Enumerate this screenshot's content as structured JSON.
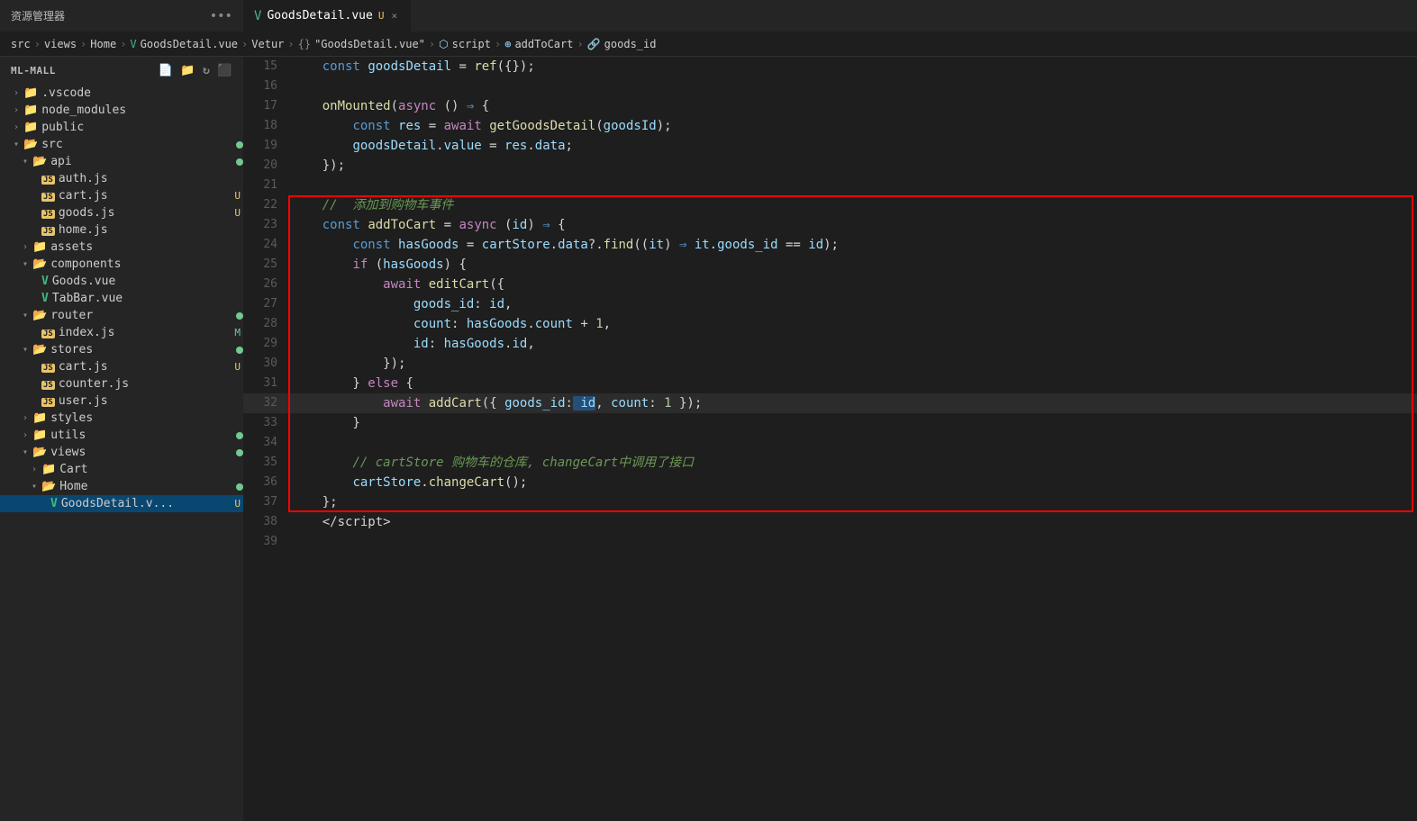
{
  "titleBar": {
    "explorerLabel": "资源管理器",
    "moreIcon": "•••",
    "tab": {
      "name": "GoodsDetail.vue",
      "modified": "U",
      "closeIcon": "×"
    }
  },
  "breadcrumb": {
    "parts": [
      "src",
      ">",
      "views",
      ">",
      "Home",
      ">",
      "GoodsDetail.vue",
      ">",
      "Vetur",
      ">",
      "{}",
      "\"GoodsDetail.vue\"",
      ">",
      "script",
      ">",
      "addToCart",
      ">",
      "goods_id"
    ]
  },
  "sidebar": {
    "title": "ML-MALL",
    "items": [
      {
        "id": "vscode",
        "label": ".vscode",
        "type": "folder",
        "indent": 1,
        "open": false
      },
      {
        "id": "node_modules",
        "label": "node_modules",
        "type": "folder",
        "indent": 1,
        "open": false
      },
      {
        "id": "public",
        "label": "public",
        "type": "folder",
        "indent": 1,
        "open": false
      },
      {
        "id": "src",
        "label": "src",
        "type": "folder",
        "indent": 1,
        "open": true,
        "badge": "dot-green"
      },
      {
        "id": "api",
        "label": "api",
        "type": "folder",
        "indent": 2,
        "open": true,
        "badge": "dot-green"
      },
      {
        "id": "auth.js",
        "label": "auth.js",
        "type": "js",
        "indent": 3
      },
      {
        "id": "cart.js",
        "label": "cart.js",
        "type": "js",
        "indent": 3,
        "badge": "U"
      },
      {
        "id": "goods.js",
        "label": "goods.js",
        "type": "js",
        "indent": 3,
        "badge": "U"
      },
      {
        "id": "home.js",
        "label": "home.js",
        "type": "js",
        "indent": 3
      },
      {
        "id": "assets",
        "label": "assets",
        "type": "folder",
        "indent": 2,
        "open": false
      },
      {
        "id": "components",
        "label": "components",
        "type": "folder",
        "indent": 2,
        "open": true
      },
      {
        "id": "Goods.vue",
        "label": "Goods.vue",
        "type": "vue",
        "indent": 3
      },
      {
        "id": "TabBar.vue",
        "label": "TabBar.vue",
        "type": "vue",
        "indent": 3
      },
      {
        "id": "router",
        "label": "router",
        "type": "folder",
        "indent": 2,
        "open": true,
        "badge": "dot-green"
      },
      {
        "id": "index.js",
        "label": "index.js",
        "type": "js",
        "indent": 3,
        "badge": "M"
      },
      {
        "id": "stores",
        "label": "stores",
        "type": "folder",
        "indent": 2,
        "open": true,
        "badge": "dot-green"
      },
      {
        "id": "cart.js2",
        "label": "cart.js",
        "type": "js",
        "indent": 3,
        "badge": "U"
      },
      {
        "id": "counter.js",
        "label": "counter.js",
        "type": "js",
        "indent": 3
      },
      {
        "id": "user.js",
        "label": "user.js",
        "type": "js",
        "indent": 3
      },
      {
        "id": "styles",
        "label": "styles",
        "type": "folder",
        "indent": 2,
        "open": false
      },
      {
        "id": "utils",
        "label": "utils",
        "type": "folder",
        "indent": 2,
        "open": false,
        "badge": "dot-green"
      },
      {
        "id": "views",
        "label": "views",
        "type": "folder",
        "indent": 2,
        "open": true,
        "badge": "dot-green"
      },
      {
        "id": "Cart",
        "label": "Cart",
        "type": "folder",
        "indent": 3,
        "open": false
      },
      {
        "id": "Home",
        "label": "Home",
        "type": "folder",
        "indent": 3,
        "open": true,
        "badge": "dot-green"
      },
      {
        "id": "GoodsDetail.vue",
        "label": "GoodsDetail.v...",
        "type": "vue",
        "indent": 4,
        "badge": "U",
        "selected": true
      }
    ]
  },
  "editor": {
    "lines": [
      {
        "num": 15,
        "tokens": [
          {
            "t": "plain",
            "v": "    "
          },
          {
            "t": "kw2",
            "v": "const"
          },
          {
            "t": "plain",
            "v": " "
          },
          {
            "t": "var",
            "v": "goodsDetail"
          },
          {
            "t": "plain",
            "v": " = "
          },
          {
            "t": "fn",
            "v": "ref"
          },
          {
            "t": "plain",
            "v": "({});"
          }
        ]
      },
      {
        "num": 16,
        "tokens": []
      },
      {
        "num": 17,
        "tokens": [
          {
            "t": "plain",
            "v": "    "
          },
          {
            "t": "fn",
            "v": "onMounted"
          },
          {
            "t": "plain",
            "v": "("
          },
          {
            "t": "kw",
            "v": "async"
          },
          {
            "t": "plain",
            "v": " () "
          },
          {
            "t": "arrow",
            "v": "⇒"
          },
          {
            "t": "plain",
            "v": " {"
          }
        ]
      },
      {
        "num": 18,
        "tokens": [
          {
            "t": "plain",
            "v": "        "
          },
          {
            "t": "kw2",
            "v": "const"
          },
          {
            "t": "plain",
            "v": " "
          },
          {
            "t": "var",
            "v": "res"
          },
          {
            "t": "plain",
            "v": " = "
          },
          {
            "t": "kw",
            "v": "await"
          },
          {
            "t": "plain",
            "v": " "
          },
          {
            "t": "fn",
            "v": "getGoodsDetail"
          },
          {
            "t": "plain",
            "v": "("
          },
          {
            "t": "var",
            "v": "goodsId"
          },
          {
            "t": "plain",
            "v": ");"
          }
        ]
      },
      {
        "num": 19,
        "tokens": [
          {
            "t": "plain",
            "v": "        "
          },
          {
            "t": "var",
            "v": "goodsDetail"
          },
          {
            "t": "plain",
            "v": "."
          },
          {
            "t": "prop",
            "v": "value"
          },
          {
            "t": "plain",
            "v": " = "
          },
          {
            "t": "var",
            "v": "res"
          },
          {
            "t": "plain",
            "v": "."
          },
          {
            "t": "prop",
            "v": "data"
          },
          {
            "t": "plain",
            "v": ";"
          }
        ]
      },
      {
        "num": 20,
        "tokens": [
          {
            "t": "plain",
            "v": "    });"
          }
        ]
      },
      {
        "num": 21,
        "tokens": []
      },
      {
        "num": 22,
        "tokens": [
          {
            "t": "plain",
            "v": "    "
          },
          {
            "t": "comment",
            "v": "//  添加到购物车事件"
          }
        ],
        "highlighted": true
      },
      {
        "num": 23,
        "tokens": [
          {
            "t": "plain",
            "v": "    "
          },
          {
            "t": "kw2",
            "v": "const"
          },
          {
            "t": "plain",
            "v": " "
          },
          {
            "t": "fn",
            "v": "addToCart"
          },
          {
            "t": "plain",
            "v": " = "
          },
          {
            "t": "kw",
            "v": "async"
          },
          {
            "t": "plain",
            "v": " ("
          },
          {
            "t": "var",
            "v": "id"
          },
          {
            "t": "plain",
            "v": ") "
          },
          {
            "t": "arrow",
            "v": "⇒"
          },
          {
            "t": "plain",
            "v": " {"
          }
        ],
        "highlighted": true
      },
      {
        "num": 24,
        "tokens": [
          {
            "t": "plain",
            "v": "        "
          },
          {
            "t": "kw2",
            "v": "const"
          },
          {
            "t": "plain",
            "v": " "
          },
          {
            "t": "var",
            "v": "hasGoods"
          },
          {
            "t": "plain",
            "v": " = "
          },
          {
            "t": "var",
            "v": "cartStore"
          },
          {
            "t": "plain",
            "v": "."
          },
          {
            "t": "prop",
            "v": "data"
          },
          {
            "t": "plain",
            "v": "?."
          },
          {
            "t": "fn",
            "v": "find"
          },
          {
            "t": "plain",
            "v": "(("
          },
          {
            "t": "var",
            "v": "it"
          },
          {
            "t": "plain",
            "v": ") "
          },
          {
            "t": "arrow",
            "v": "⇒"
          },
          {
            "t": "plain",
            "v": " "
          },
          {
            "t": "var",
            "v": "it"
          },
          {
            "t": "plain",
            "v": "."
          },
          {
            "t": "prop",
            "v": "goods_id"
          },
          {
            "t": "plain",
            "v": " == "
          },
          {
            "t": "var",
            "v": "id"
          },
          {
            "t": "plain",
            "v": ");"
          }
        ],
        "highlighted": true
      },
      {
        "num": 25,
        "tokens": [
          {
            "t": "plain",
            "v": "        "
          },
          {
            "t": "kw",
            "v": "if"
          },
          {
            "t": "plain",
            "v": " ("
          },
          {
            "t": "var",
            "v": "hasGoods"
          },
          {
            "t": "plain",
            "v": ") {"
          }
        ],
        "highlighted": true
      },
      {
        "num": 26,
        "tokens": [
          {
            "t": "plain",
            "v": "            "
          },
          {
            "t": "kw",
            "v": "await"
          },
          {
            "t": "plain",
            "v": " "
          },
          {
            "t": "fn",
            "v": "editCart"
          },
          {
            "t": "plain",
            "v": "({"
          }
        ],
        "highlighted": true
      },
      {
        "num": 27,
        "tokens": [
          {
            "t": "plain",
            "v": "                "
          },
          {
            "t": "prop",
            "v": "goods_id"
          },
          {
            "t": "plain",
            "v": ": "
          },
          {
            "t": "var",
            "v": "id"
          },
          {
            "t": "plain",
            "v": ","
          }
        ],
        "highlighted": true
      },
      {
        "num": 28,
        "tokens": [
          {
            "t": "plain",
            "v": "                "
          },
          {
            "t": "prop",
            "v": "count"
          },
          {
            "t": "plain",
            "v": ": "
          },
          {
            "t": "var",
            "v": "hasGoods"
          },
          {
            "t": "plain",
            "v": "."
          },
          {
            "t": "prop",
            "v": "count"
          },
          {
            "t": "plain",
            "v": " + "
          },
          {
            "t": "num",
            "v": "1"
          },
          {
            "t": "plain",
            "v": ","
          }
        ],
        "highlighted": true
      },
      {
        "num": 29,
        "tokens": [
          {
            "t": "plain",
            "v": "                "
          },
          {
            "t": "prop",
            "v": "id"
          },
          {
            "t": "plain",
            "v": ": "
          },
          {
            "t": "var",
            "v": "hasGoods"
          },
          {
            "t": "plain",
            "v": "."
          },
          {
            "t": "prop",
            "v": "id"
          },
          {
            "t": "plain",
            "v": ","
          }
        ],
        "highlighted": true
      },
      {
        "num": 30,
        "tokens": [
          {
            "t": "plain",
            "v": "            });"
          }
        ],
        "highlighted": true
      },
      {
        "num": 31,
        "tokens": [
          {
            "t": "plain",
            "v": "        } "
          },
          {
            "t": "kw",
            "v": "else"
          },
          {
            "t": "plain",
            "v": " {"
          }
        ],
        "highlighted": true
      },
      {
        "num": 32,
        "tokens": [
          {
            "t": "plain",
            "v": "            "
          },
          {
            "t": "kw",
            "v": "await"
          },
          {
            "t": "plain",
            "v": " "
          },
          {
            "t": "fn",
            "v": "addCart"
          },
          {
            "t": "plain",
            "v": "({ "
          },
          {
            "t": "prop",
            "v": "goods_id"
          },
          {
            "t": "plain",
            "v": ":"
          },
          {
            "t": "sel",
            "v": " id"
          },
          {
            "t": "plain",
            "v": ", "
          },
          {
            "t": "prop",
            "v": "count"
          },
          {
            "t": "plain",
            "v": ": "
          },
          {
            "t": "num",
            "v": "1"
          },
          {
            "t": "plain",
            "v": " });"
          }
        ],
        "highlighted": true,
        "current": true
      },
      {
        "num": 33,
        "tokens": [
          {
            "t": "plain",
            "v": "        }"
          }
        ],
        "highlighted": true
      },
      {
        "num": 34,
        "tokens": [],
        "highlighted": true
      },
      {
        "num": 35,
        "tokens": [
          {
            "t": "plain",
            "v": "        "
          },
          {
            "t": "comment",
            "v": "// cartStore 购物车的仓库, changeCart中调用了接口"
          }
        ],
        "highlighted": true
      },
      {
        "num": 36,
        "tokens": [
          {
            "t": "plain",
            "v": "        "
          },
          {
            "t": "var",
            "v": "cartStore"
          },
          {
            "t": "plain",
            "v": "."
          },
          {
            "t": "fn",
            "v": "changeCart"
          },
          {
            "t": "plain",
            "v": "();"
          }
        ],
        "highlighted": true
      },
      {
        "num": 37,
        "tokens": [
          {
            "t": "plain",
            "v": "    };"
          }
        ],
        "highlighted": true
      },
      {
        "num": 38,
        "tokens": [
          {
            "t": "plain",
            "v": "    </"
          },
          {
            "t": "plain",
            "v": "script>"
          }
        ]
      },
      {
        "num": 39,
        "tokens": []
      }
    ]
  }
}
